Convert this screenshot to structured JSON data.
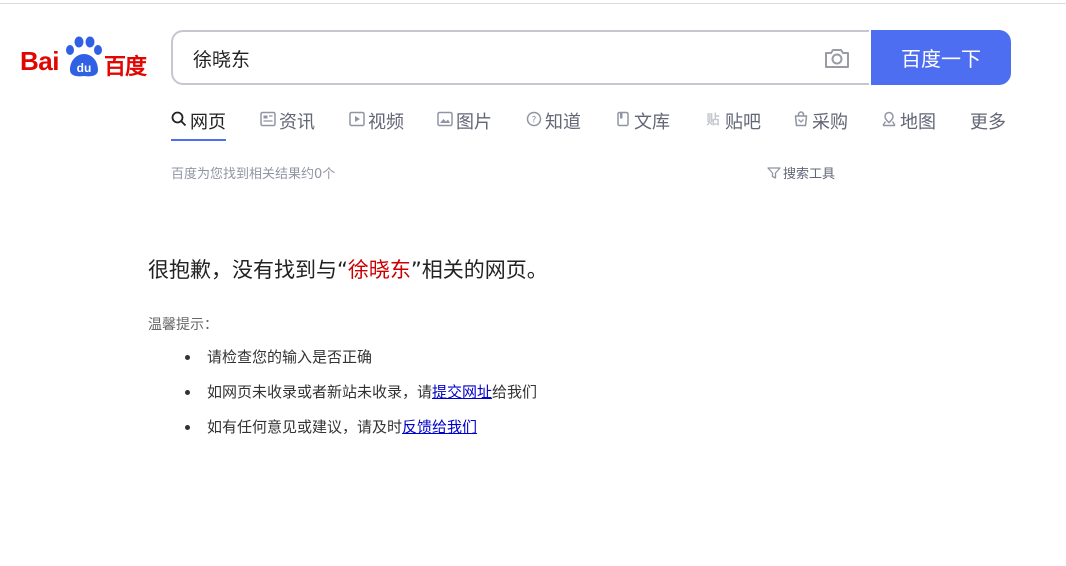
{
  "logo": {
    "left_text": "Bai",
    "paw_text": "du",
    "right_text": "百度"
  },
  "search": {
    "query": "徐晓东",
    "button_label": "百度一下"
  },
  "tabs": [
    {
      "label": "网页",
      "icon": "search-icon",
      "active": true
    },
    {
      "label": "资讯",
      "icon": "news-icon"
    },
    {
      "label": "视频",
      "icon": "video-icon"
    },
    {
      "label": "图片",
      "icon": "image-icon"
    },
    {
      "label": "知道",
      "icon": "question-icon"
    },
    {
      "label": "文库",
      "icon": "document-icon"
    },
    {
      "label": "贴吧",
      "icon": "tieba-icon"
    },
    {
      "label": "采购",
      "icon": "shopping-bag-icon"
    },
    {
      "label": "地图",
      "icon": "map-icon"
    },
    {
      "label": "更多",
      "icon": ""
    }
  ],
  "stats": {
    "text": "百度为您找到相关结果约0个"
  },
  "tools": {
    "label": "搜索工具",
    "icon": "filter-icon"
  },
  "no_results": {
    "prefix": "很抱歉，没有找到与“",
    "query": "徐晓东",
    "suffix": "”相关的网页。"
  },
  "hints": {
    "title": "温馨提示：",
    "item1": "请检查您的输入是否正确",
    "item2_prefix": "如网页未收录或者新站未收录，请",
    "item2_link": "提交网址",
    "item2_suffix": "给我们",
    "item3_prefix": "如有任何意见或建议，请及时",
    "item3_link": "反馈给我们"
  },
  "colors": {
    "brand_red": "#e10602",
    "brand_blue": "#4e6ef2",
    "link": "#0000cc",
    "query_red": "#c00"
  }
}
